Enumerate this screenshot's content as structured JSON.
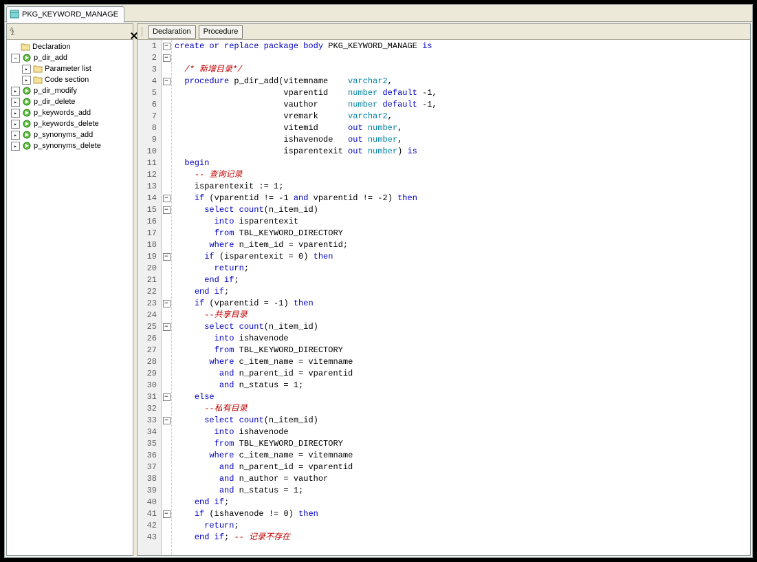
{
  "tab": {
    "title": "PKG_KEYWORD_MANAGE",
    "icon": "package-icon"
  },
  "leftToolbar": {
    "sortIcon": "sort-az-icon",
    "closeIcon": "close-icon"
  },
  "rightToolbar": {
    "btnDeclaration": "Declaration",
    "btnProcedure": "Procedure"
  },
  "tree": {
    "items": [
      {
        "depth": 0,
        "twist": "",
        "icon": "folder",
        "label": "Declaration"
      },
      {
        "depth": 0,
        "twist": "-",
        "icon": "proc",
        "label": "p_dir_add"
      },
      {
        "depth": 1,
        "twist": ">",
        "icon": "folder",
        "label": "Parameter list"
      },
      {
        "depth": 1,
        "twist": ">",
        "icon": "folder",
        "label": "Code section"
      },
      {
        "depth": 0,
        "twist": ">",
        "icon": "proc",
        "label": "p_dir_modify"
      },
      {
        "depth": 0,
        "twist": ">",
        "icon": "proc",
        "label": "p_dir_delete"
      },
      {
        "depth": 0,
        "twist": ">",
        "icon": "proc",
        "label": "p_keywords_add"
      },
      {
        "depth": 0,
        "twist": ">",
        "icon": "proc",
        "label": "p_keywords_delete"
      },
      {
        "depth": 0,
        "twist": ">",
        "icon": "proc",
        "label": "p_synonyms_add"
      },
      {
        "depth": 0,
        "twist": ">",
        "icon": "proc",
        "label": "p_synonyms_delete"
      }
    ]
  },
  "code": {
    "lines": [
      {
        "n": 1,
        "fold": "-",
        "segs": [
          [
            "kw",
            "create or replace package body"
          ],
          [
            "",
            " PKG_KEYWORD_MANAGE "
          ],
          [
            "kw",
            "is"
          ]
        ]
      },
      {
        "n": 2,
        "fold": "-",
        "segs": [
          [
            "",
            ""
          ]
        ]
      },
      {
        "n": 3,
        "fold": "",
        "segs": [
          [
            "",
            "  "
          ],
          [
            "cm",
            "/* 新增目录*/"
          ]
        ]
      },
      {
        "n": 4,
        "fold": "-",
        "segs": [
          [
            "",
            "  "
          ],
          [
            "kw",
            "procedure"
          ],
          [
            "",
            " p_dir_add(vitemname    "
          ],
          [
            "tp",
            "varchar2"
          ],
          [
            "",
            ","
          ]
        ]
      },
      {
        "n": 5,
        "fold": "",
        "segs": [
          [
            "",
            "                      vparentid    "
          ],
          [
            "tp",
            "number"
          ],
          [
            "",
            " "
          ],
          [
            "kw",
            "default"
          ],
          [
            "",
            " -"
          ],
          [
            "",
            "1"
          ],
          [
            "",
            ","
          ]
        ]
      },
      {
        "n": 6,
        "fold": "",
        "segs": [
          [
            "",
            "                      vauthor      "
          ],
          [
            "tp",
            "number"
          ],
          [
            "",
            " "
          ],
          [
            "kw",
            "default"
          ],
          [
            "",
            " -"
          ],
          [
            "",
            "1"
          ],
          [
            "",
            ","
          ]
        ]
      },
      {
        "n": 7,
        "fold": "",
        "segs": [
          [
            "",
            "                      vremark      "
          ],
          [
            "tp",
            "varchar2"
          ],
          [
            "",
            ","
          ]
        ]
      },
      {
        "n": 8,
        "fold": "",
        "segs": [
          [
            "",
            "                      vitemid      "
          ],
          [
            "kw",
            "out"
          ],
          [
            "",
            " "
          ],
          [
            "tp",
            "number"
          ],
          [
            "",
            ","
          ]
        ]
      },
      {
        "n": 9,
        "fold": "",
        "segs": [
          [
            "",
            "                      ishavenode   "
          ],
          [
            "kw",
            "out"
          ],
          [
            "",
            " "
          ],
          [
            "tp",
            "number"
          ],
          [
            "",
            ","
          ]
        ]
      },
      {
        "n": 10,
        "fold": "",
        "segs": [
          [
            "",
            "                      isparentexit "
          ],
          [
            "kw",
            "out"
          ],
          [
            "",
            " "
          ],
          [
            "tp",
            "number"
          ],
          [
            "",
            ") "
          ],
          [
            "kw",
            "is"
          ]
        ]
      },
      {
        "n": 11,
        "fold": "",
        "segs": [
          [
            "",
            "  "
          ],
          [
            "kw",
            "begin"
          ]
        ]
      },
      {
        "n": 12,
        "fold": "",
        "segs": [
          [
            "",
            "    "
          ],
          [
            "cm",
            "-- 查询记录"
          ]
        ]
      },
      {
        "n": 13,
        "fold": "",
        "segs": [
          [
            "",
            "    isparentexit := "
          ],
          [
            "",
            "1"
          ],
          [
            "",
            ";"
          ]
        ]
      },
      {
        "n": 14,
        "fold": "-",
        "segs": [
          [
            "",
            "    "
          ],
          [
            "kw",
            "if"
          ],
          [
            "",
            " (vparentid != -"
          ],
          [
            "",
            "1"
          ],
          [
            "",
            " "
          ],
          [
            "kw",
            "and"
          ],
          [
            "",
            " vparentid != -"
          ],
          [
            "",
            "2"
          ],
          [
            "",
            ") "
          ],
          [
            "kw",
            "then"
          ]
        ]
      },
      {
        "n": 15,
        "fold": "-",
        "segs": [
          [
            "",
            "      "
          ],
          [
            "kw",
            "select"
          ],
          [
            "",
            " "
          ],
          [
            "kw",
            "count"
          ],
          [
            "",
            "(n_item_id)"
          ]
        ]
      },
      {
        "n": 16,
        "fold": "",
        "segs": [
          [
            "",
            "        "
          ],
          [
            "kw",
            "into"
          ],
          [
            "",
            " isparentexit"
          ]
        ]
      },
      {
        "n": 17,
        "fold": "",
        "segs": [
          [
            "",
            "        "
          ],
          [
            "kw",
            "from"
          ],
          [
            "",
            " TBL_KEYWORD_DIRECTORY"
          ]
        ]
      },
      {
        "n": 18,
        "fold": "",
        "segs": [
          [
            "",
            "       "
          ],
          [
            "kw",
            "where"
          ],
          [
            "",
            " n_item_id = vparentid;"
          ]
        ]
      },
      {
        "n": 19,
        "fold": "-",
        "segs": [
          [
            "",
            "      "
          ],
          [
            "kw",
            "if"
          ],
          [
            "",
            " (isparentexit = "
          ],
          [
            "",
            "0"
          ],
          [
            "",
            ") "
          ],
          [
            "kw",
            "then"
          ]
        ]
      },
      {
        "n": 20,
        "fold": "",
        "segs": [
          [
            "",
            "        "
          ],
          [
            "kw",
            "return"
          ],
          [
            "",
            ";"
          ]
        ]
      },
      {
        "n": 21,
        "fold": "",
        "segs": [
          [
            "",
            "      "
          ],
          [
            "kw",
            "end"
          ],
          [
            "",
            " "
          ],
          [
            "kw",
            "if"
          ],
          [
            "",
            ";"
          ]
        ]
      },
      {
        "n": 22,
        "fold": "",
        "segs": [
          [
            "",
            "    "
          ],
          [
            "kw",
            "end"
          ],
          [
            "",
            " "
          ],
          [
            "kw",
            "if"
          ],
          [
            "",
            ";"
          ]
        ]
      },
      {
        "n": 23,
        "fold": "-",
        "segs": [
          [
            "",
            "    "
          ],
          [
            "kw",
            "if"
          ],
          [
            "",
            " (vparentid = -"
          ],
          [
            "",
            "1"
          ],
          [
            "",
            ") "
          ],
          [
            "kw",
            "then"
          ]
        ]
      },
      {
        "n": 24,
        "fold": "",
        "segs": [
          [
            "",
            "      "
          ],
          [
            "cm",
            "--共享目录"
          ]
        ]
      },
      {
        "n": 25,
        "fold": "-",
        "segs": [
          [
            "",
            "      "
          ],
          [
            "kw",
            "select"
          ],
          [
            "",
            " "
          ],
          [
            "kw",
            "count"
          ],
          [
            "",
            "(n_item_id)"
          ]
        ]
      },
      {
        "n": 26,
        "fold": "",
        "segs": [
          [
            "",
            "        "
          ],
          [
            "kw",
            "into"
          ],
          [
            "",
            " ishavenode"
          ]
        ]
      },
      {
        "n": 27,
        "fold": "",
        "segs": [
          [
            "",
            "        "
          ],
          [
            "kw",
            "from"
          ],
          [
            "",
            " TBL_KEYWORD_DIRECTORY"
          ]
        ]
      },
      {
        "n": 28,
        "fold": "",
        "segs": [
          [
            "",
            "       "
          ],
          [
            "kw",
            "where"
          ],
          [
            "",
            " c_item_name = vitemname"
          ]
        ]
      },
      {
        "n": 29,
        "fold": "",
        "segs": [
          [
            "",
            "         "
          ],
          [
            "kw",
            "and"
          ],
          [
            "",
            " n_parent_id = vparentid"
          ]
        ]
      },
      {
        "n": 30,
        "fold": "",
        "segs": [
          [
            "",
            "         "
          ],
          [
            "kw",
            "and"
          ],
          [
            "",
            " n_status = "
          ],
          [
            "",
            "1"
          ],
          [
            "",
            ";"
          ]
        ]
      },
      {
        "n": 31,
        "fold": "-",
        "segs": [
          [
            "",
            "    "
          ],
          [
            "kw",
            "else"
          ]
        ]
      },
      {
        "n": 32,
        "fold": "",
        "segs": [
          [
            "",
            "      "
          ],
          [
            "cm",
            "--私有目录"
          ]
        ]
      },
      {
        "n": 33,
        "fold": "-",
        "segs": [
          [
            "",
            "      "
          ],
          [
            "kw",
            "select"
          ],
          [
            "",
            " "
          ],
          [
            "kw",
            "count"
          ],
          [
            "",
            "(n_item_id)"
          ]
        ]
      },
      {
        "n": 34,
        "fold": "",
        "segs": [
          [
            "",
            "        "
          ],
          [
            "kw",
            "into"
          ],
          [
            "",
            " ishavenode"
          ]
        ]
      },
      {
        "n": 35,
        "fold": "",
        "segs": [
          [
            "",
            "        "
          ],
          [
            "kw",
            "from"
          ],
          [
            "",
            " TBL_KEYWORD_DIRECTORY"
          ]
        ]
      },
      {
        "n": 36,
        "fold": "",
        "segs": [
          [
            "",
            "       "
          ],
          [
            "kw",
            "where"
          ],
          [
            "",
            " c_item_name = vitemname"
          ]
        ]
      },
      {
        "n": 37,
        "fold": "",
        "segs": [
          [
            "",
            "         "
          ],
          [
            "kw",
            "and"
          ],
          [
            "",
            " n_parent_id = vparentid"
          ]
        ]
      },
      {
        "n": 38,
        "fold": "",
        "segs": [
          [
            "",
            "         "
          ],
          [
            "kw",
            "and"
          ],
          [
            "",
            " n_author = vauthor"
          ]
        ]
      },
      {
        "n": 39,
        "fold": "",
        "segs": [
          [
            "",
            "         "
          ],
          [
            "kw",
            "and"
          ],
          [
            "",
            " n_status = "
          ],
          [
            "",
            "1"
          ],
          [
            "",
            ";"
          ]
        ]
      },
      {
        "n": 40,
        "fold": "",
        "segs": [
          [
            "",
            "    "
          ],
          [
            "kw",
            "end"
          ],
          [
            "",
            " "
          ],
          [
            "kw",
            "if"
          ],
          [
            "",
            ";"
          ]
        ]
      },
      {
        "n": 41,
        "fold": "-",
        "segs": [
          [
            "",
            "    "
          ],
          [
            "kw",
            "if"
          ],
          [
            "",
            " (ishavenode != "
          ],
          [
            "",
            "0"
          ],
          [
            "",
            ") "
          ],
          [
            "kw",
            "then"
          ]
        ]
      },
      {
        "n": 42,
        "fold": "",
        "segs": [
          [
            "",
            "      "
          ],
          [
            "kw",
            "return"
          ],
          [
            "",
            ";"
          ]
        ]
      },
      {
        "n": 43,
        "fold": "",
        "segs": [
          [
            "",
            "    "
          ],
          [
            "kw",
            "end"
          ],
          [
            "",
            " "
          ],
          [
            "kw",
            "if"
          ],
          [
            "",
            "; "
          ],
          [
            "cm",
            "-- 记录不存在"
          ]
        ]
      }
    ]
  }
}
